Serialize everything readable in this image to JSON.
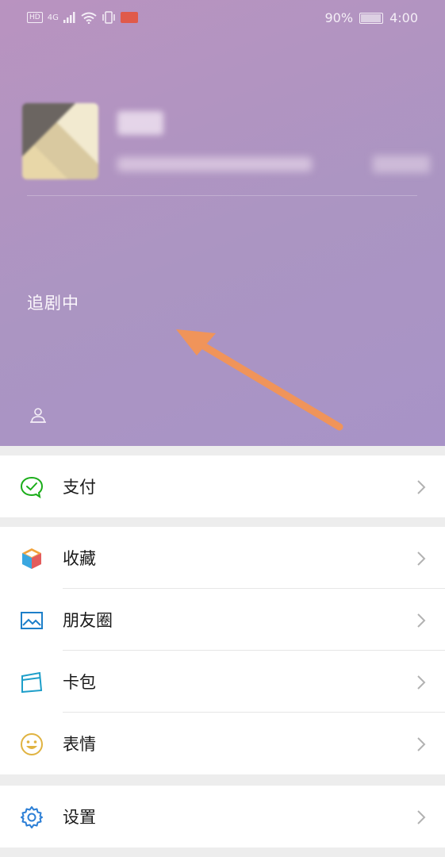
{
  "status_bar": {
    "left_indicators": [
      "HD",
      "4G"
    ],
    "battery": "90%",
    "time": "4:00"
  },
  "profile": {
    "status_text": "追剧中"
  },
  "menu": {
    "pay": "支付",
    "favorites": "收藏",
    "moments": "朋友圈",
    "cards": "卡包",
    "stickers": "表情",
    "settings": "设置"
  },
  "colors": {
    "header_gradient_start": "#b993c0",
    "header_gradient_end": "#a893c7",
    "arrow": "#f0945a",
    "pay_icon": "#1aad19",
    "cards_icon": "#1d9ec9",
    "settings_icon": "#2c7fd6",
    "stickers_icon": "#e0b341"
  }
}
